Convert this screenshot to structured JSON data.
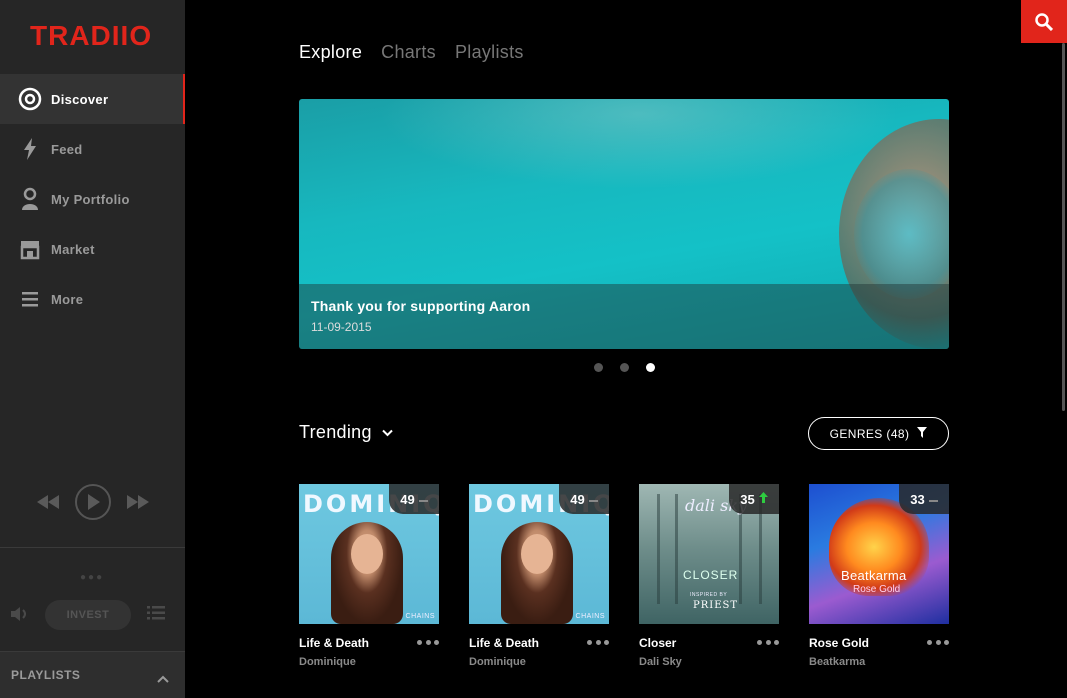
{
  "app": {
    "logo": "TRADIIO"
  },
  "sidebar": {
    "items": [
      {
        "label": "Discover",
        "icon": "disc-icon",
        "active": true
      },
      {
        "label": "Feed",
        "icon": "lightning-icon"
      },
      {
        "label": "My Portfolio",
        "icon": "user-icon"
      },
      {
        "label": "Market",
        "icon": "store-icon"
      },
      {
        "label": "More",
        "icon": "menu-icon"
      }
    ],
    "player": {
      "invest_label": "INVEST"
    },
    "playlists_label": "PLAYLISTS"
  },
  "tabs": [
    {
      "label": "Explore",
      "active": true
    },
    {
      "label": "Charts"
    },
    {
      "label": "Playlists"
    }
  ],
  "hero": {
    "title": "Thank you for supporting Aaron",
    "date": "11-09-2015",
    "slides": 3,
    "active_slide": 3
  },
  "trending": {
    "label": "Trending",
    "genres_label": "GENRES (48)"
  },
  "cards": [
    {
      "title": "Life & Death",
      "artist": "Dominique",
      "rank": "49",
      "trend": "same",
      "cover_text": "DOMINIQUE",
      "cover_sub": "CHAINS"
    },
    {
      "title": "Life & Death",
      "artist": "Dominique",
      "rank": "49",
      "trend": "same",
      "cover_text": "DOMINIQUE",
      "cover_sub": "CHAINS"
    },
    {
      "title": "Closer",
      "artist": "Dali Sky",
      "rank": "35",
      "trend": "up",
      "cover_text": "dali sky",
      "cover_title": "CLOSER",
      "cover_inspired": "INSPIRED BY",
      "cover_sub": "PRIEST"
    },
    {
      "title": "Rose Gold",
      "artist": "Beatkarma",
      "rank": "33",
      "trend": "same",
      "cover_text": "Beatkarma",
      "cover_sub": "Rose Gold"
    }
  ],
  "colors": {
    "accent": "#e1251b",
    "trend_up": "#2ecc40",
    "sidebar_bg": "#262626"
  }
}
